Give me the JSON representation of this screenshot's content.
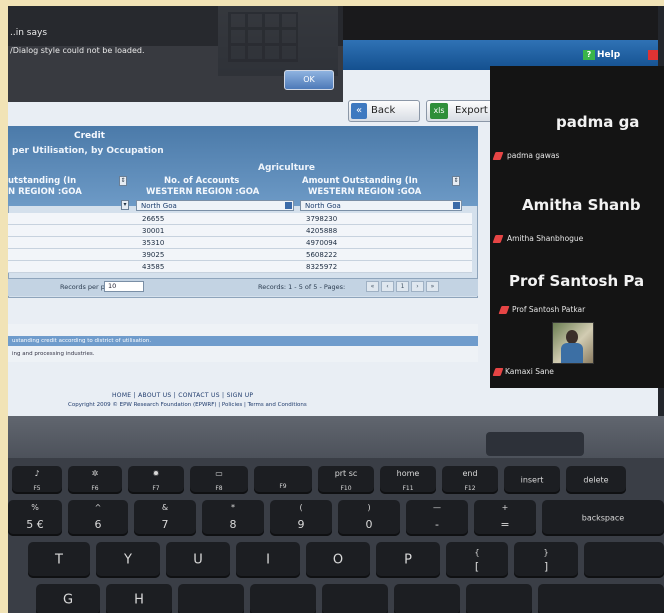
{
  "dialog": {
    "title": "..in says",
    "message": "/Dialog style could not be loaded.",
    "ok_label": "OK"
  },
  "header": {
    "help_label": "Help"
  },
  "toolbar": {
    "back_label": "Back",
    "export_label": "Export"
  },
  "report": {
    "section_title": "Credit",
    "subtitle": "per Utilisation, by Occupation",
    "group_header": "Agriculture",
    "col1_header_line1": "utstanding (In",
    "col1_header_line2": "N REGION :GOA",
    "col2_header_line1": "No. of Accounts",
    "col2_header_line2": "WESTERN REGION :GOA",
    "col3_header_line1": "Amount Outstanding (In",
    "col3_header_line2": "WESTERN REGION :GOA",
    "col2_filter": "North Goa",
    "col3_filter": "North Goa",
    "rows": [
      {
        "accounts": "26655",
        "amount": "3798230"
      },
      {
        "accounts": "30001",
        "amount": "4205888"
      },
      {
        "accounts": "35310",
        "amount": "4970094"
      },
      {
        "accounts": "39025",
        "amount": "5608222"
      },
      {
        "accounts": "43585",
        "amount": "8325972"
      }
    ],
    "pager": {
      "records_per_page_label": "Records per page:",
      "records_per_page_value": "10",
      "records_label": "Records: 1 - 5 of 5 - Pages:",
      "page_current": "1"
    }
  },
  "notes": {
    "line1": "ustanding credit according to district of utilisation.",
    "line2": "ing and processing industries."
  },
  "footer": {
    "links": "HOME | ABOUT US | CONTACT US | SIGN UP",
    "copyright": "Copyright 2009 © EPW Research Foundation (EPWRF) | Policies | Terms and Conditions"
  },
  "video_panel": {
    "participants": [
      {
        "big_name": "padma ga",
        "small_name": "padma gawas"
      },
      {
        "big_name": "Amitha  Shanb",
        "small_name": "Amitha Shanbhogue"
      },
      {
        "big_name": "Prof Santosh Pa",
        "small_name": "Prof Santosh Patkar"
      },
      {
        "big_name": "",
        "small_name": "Kamaxi Sane"
      }
    ]
  },
  "keyboard": {
    "fn_row": [
      "F5",
      "F6",
      "F7",
      "F8",
      "F9",
      "prt sc",
      "home",
      "end",
      "insert",
      "delete"
    ],
    "fn_row_sub": [
      "",
      "",
      "",
      "",
      "",
      "F10",
      "F11",
      "F12",
      "",
      ""
    ],
    "num_row_top": [
      "%",
      "^",
      "&",
      "*",
      "(",
      ")",
      "—",
      "+"
    ],
    "num_row_bottom": [
      "5 €",
      "6",
      "7",
      "8",
      "9",
      "0",
      "-",
      "="
    ],
    "backspace": "backspace",
    "letters_row": [
      "T",
      "Y",
      "U",
      "I",
      "O",
      "P"
    ],
    "brackets_top": [
      "{",
      "}"
    ],
    "brackets_bottom": [
      "[",
      "]"
    ],
    "bottom_row": [
      "G",
      "H"
    ]
  }
}
